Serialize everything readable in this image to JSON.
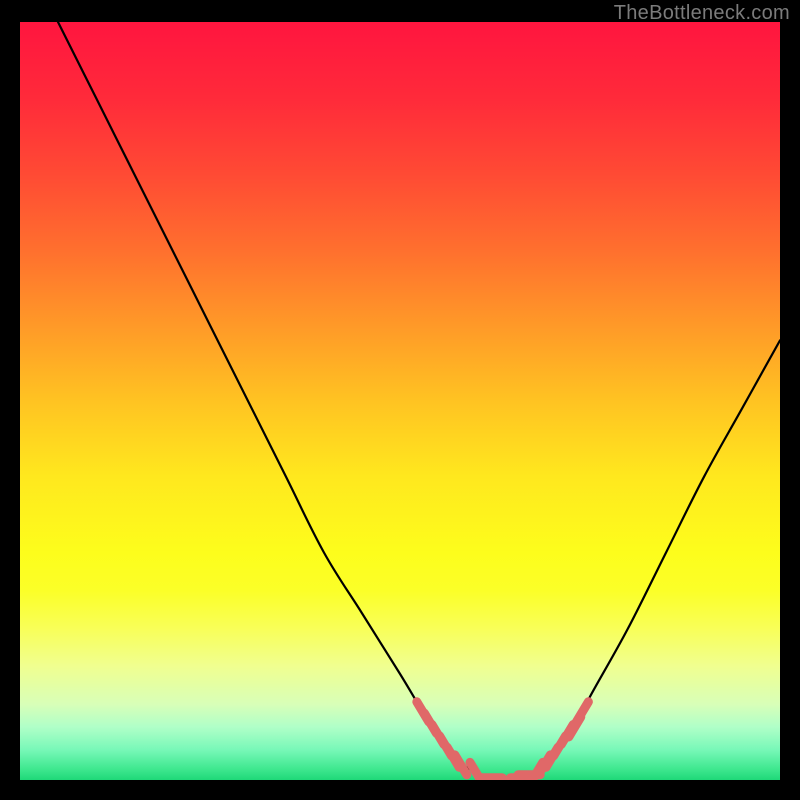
{
  "watermark": "TheBottleneck.com",
  "gradient_stops": [
    {
      "offset": 0.0,
      "color": "#ff153f"
    },
    {
      "offset": 0.1,
      "color": "#ff2a3a"
    },
    {
      "offset": 0.2,
      "color": "#ff4a34"
    },
    {
      "offset": 0.3,
      "color": "#ff6f2e"
    },
    {
      "offset": 0.4,
      "color": "#ff9928"
    },
    {
      "offset": 0.5,
      "color": "#ffc322"
    },
    {
      "offset": 0.6,
      "color": "#ffe81e"
    },
    {
      "offset": 0.7,
      "color": "#fdfd1c"
    },
    {
      "offset": 0.75,
      "color": "#fbff28"
    },
    {
      "offset": 0.8,
      "color": "#f8ff58"
    },
    {
      "offset": 0.85,
      "color": "#f0ff90"
    },
    {
      "offset": 0.9,
      "color": "#d8ffb8"
    },
    {
      "offset": 0.93,
      "color": "#b0ffc8"
    },
    {
      "offset": 0.96,
      "color": "#78f8b8"
    },
    {
      "offset": 0.985,
      "color": "#40e890"
    },
    {
      "offset": 1.0,
      "color": "#1ed878"
    }
  ],
  "marker_color": "#e06868",
  "curve_color": "#000000",
  "chart_data": {
    "type": "line",
    "title": "",
    "xlabel": "",
    "ylabel": "",
    "xlim": [
      0,
      100
    ],
    "ylim": [
      0,
      100
    ],
    "series": [
      {
        "name": "bottleneck-curve",
        "x": [
          5,
          10,
          15,
          20,
          25,
          30,
          35,
          40,
          45,
          50,
          53,
          55,
          57,
          60,
          63,
          65,
          68,
          70,
          73,
          75,
          80,
          85,
          90,
          95,
          100
        ],
        "y": [
          100,
          90,
          80,
          70,
          60,
          50,
          40,
          30,
          22,
          14,
          9,
          6,
          3,
          1,
          0,
          0,
          1,
          3,
          7,
          11,
          20,
          30,
          40,
          49,
          58
        ]
      },
      {
        "name": "highlight-markers",
        "x": [
          53,
          54,
          55,
          56,
          57,
          58,
          60,
          62,
          63,
          64,
          65,
          66,
          67,
          68,
          69,
          70,
          71,
          72,
          73,
          74
        ],
        "y": [
          9,
          7.5,
          6,
          4.5,
          3,
          2,
          1,
          0.3,
          0,
          0,
          0,
          0.3,
          0.7,
          1,
          2,
          3,
          4.5,
          6,
          7,
          9
        ]
      }
    ]
  }
}
